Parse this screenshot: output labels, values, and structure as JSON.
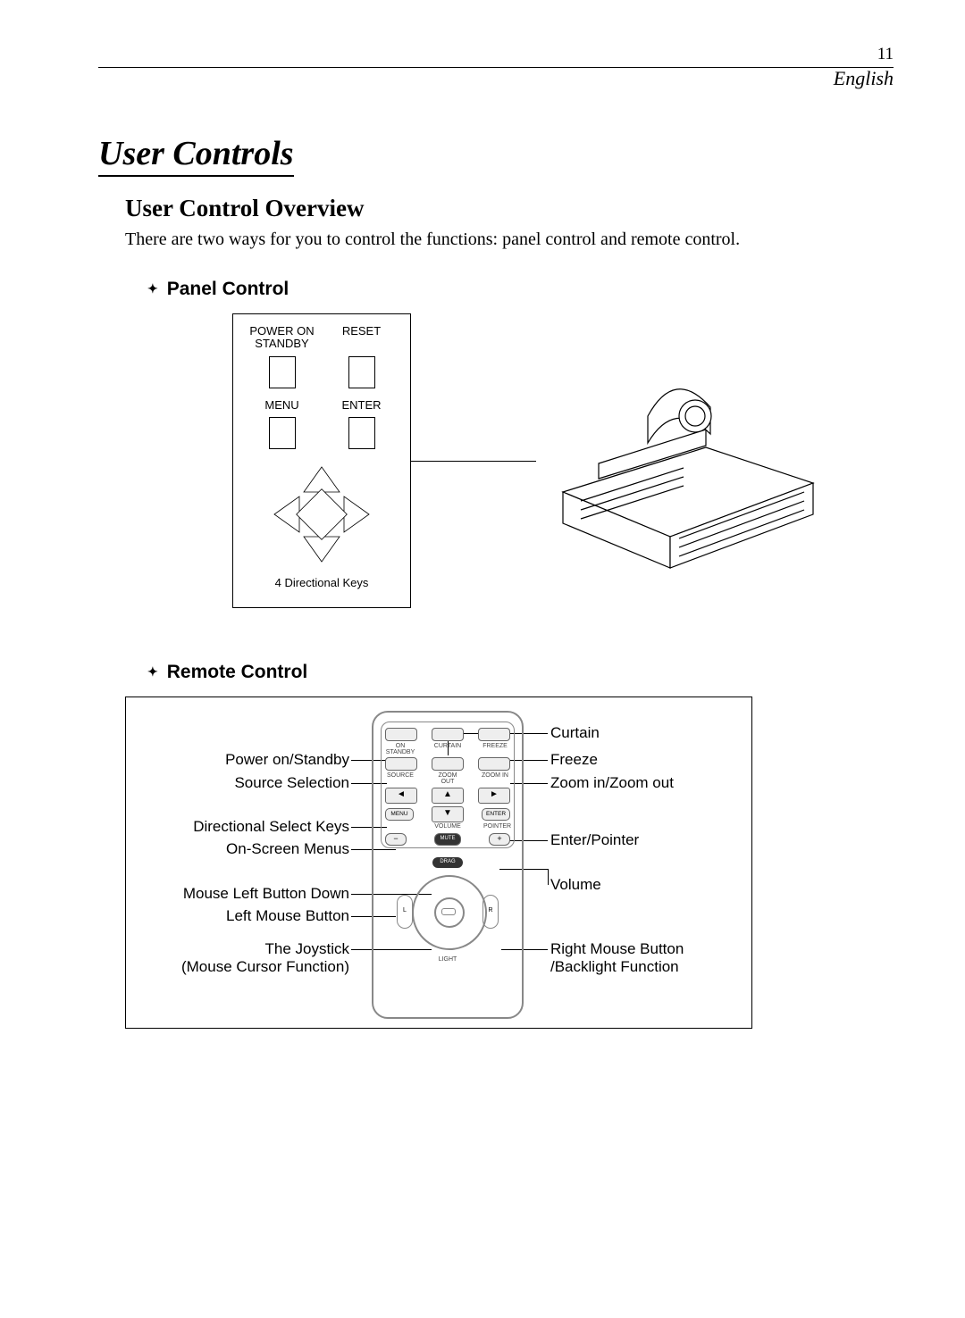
{
  "page_number": "11",
  "language": "English",
  "title": "User Controls",
  "subtitle": "User Control Overview",
  "intro": "There are two ways for you to control the functions: panel control and remote control.",
  "panel": {
    "heading": "Panel Control",
    "labels": {
      "power": "POWER ON STANDBY",
      "reset": "RESET",
      "menu": "MENU",
      "enter": "ENTER"
    },
    "caption": "4 Directional Keys"
  },
  "remote": {
    "heading": "Remote Control",
    "buttons": {
      "on_standby": "ON STANDBY",
      "curtain": "CURTAIN",
      "freeze": "FREEZE",
      "source": "SOURCE",
      "zoomout": "ZOOM OUT",
      "zoomin": "ZOOM IN",
      "menu": "MENU",
      "enter": "ENTER",
      "pointer": "POINTER",
      "volume": "VOLUME",
      "mute": "MUTE",
      "drag": "DRAG",
      "light": "LIGHT",
      "left_side": "L",
      "right_side": "R",
      "arrow_left": "◄",
      "arrow_up": "▲",
      "arrow_right": "►",
      "arrow_down": "▼",
      "minus": "−",
      "plus": "+"
    },
    "callouts_left": {
      "power": "Power on/Standby",
      "source": "Source Selection",
      "dir": "Directional Select Keys",
      "osm": "On-Screen Menus",
      "mlbd": "Mouse Left Button Down",
      "lmb": "Left Mouse Button",
      "joy1": "The Joystick",
      "joy2": "(Mouse Cursor Function)"
    },
    "callouts_right": {
      "curtain": "Curtain",
      "freeze": "Freeze",
      "zoom": "Zoom in/Zoom out",
      "enter": "Enter/Pointer",
      "volume": "Volume",
      "rmb1": "Right Mouse Button",
      "rmb2": "/Backlight Function"
    }
  }
}
